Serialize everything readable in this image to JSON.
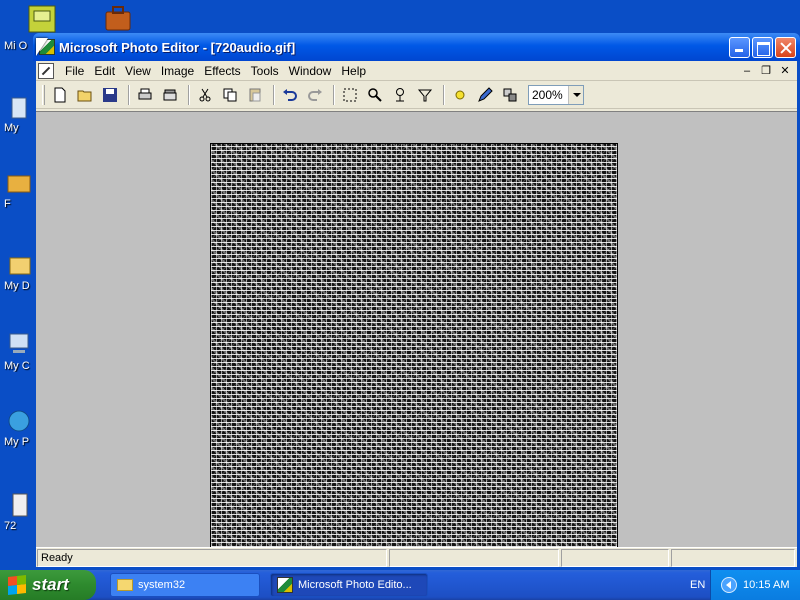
{
  "desktop": {
    "icons": [
      {
        "label": "Mi O"
      },
      {
        "label": "My"
      },
      {
        "label": "F"
      },
      {
        "label": "My D"
      },
      {
        "label": "My C"
      },
      {
        "label": "My P"
      },
      {
        "label": "72"
      }
    ]
  },
  "window": {
    "title": "Microsoft Photo Editor - [720audio.gif]",
    "menu": [
      "File",
      "Edit",
      "View",
      "Image",
      "Effects",
      "Tools",
      "Window",
      "Help"
    ],
    "mdi_controls": [
      "–",
      "❐",
      "✕"
    ],
    "toolbar": {
      "zoom_value": "200%"
    },
    "status": {
      "text": "Ready"
    }
  },
  "taskbar": {
    "start_label": "start",
    "tasks": [
      {
        "label": "system32",
        "active": false
      },
      {
        "label": "Microsoft Photo Edito...",
        "active": true
      }
    ],
    "language": "EN",
    "clock": "10:15 AM"
  },
  "colors": {
    "desktop_bg": "#0a4ec6",
    "titlebar": "#0058e6",
    "workspace_bg": "#c0c0c0",
    "start_green": "#2e8a2e"
  }
}
